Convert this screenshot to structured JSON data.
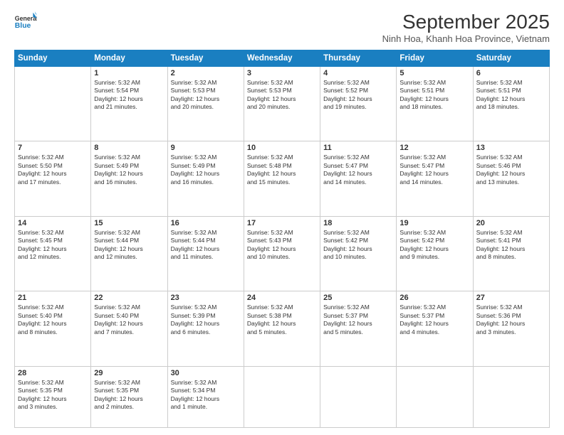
{
  "header": {
    "logo_line1": "General",
    "logo_line2": "Blue",
    "month": "September 2025",
    "location": "Ninh Hoa, Khanh Hoa Province, Vietnam"
  },
  "weekdays": [
    "Sunday",
    "Monday",
    "Tuesday",
    "Wednesday",
    "Thursday",
    "Friday",
    "Saturday"
  ],
  "rows": [
    [
      {
        "day": "",
        "lines": []
      },
      {
        "day": "1",
        "lines": [
          "Sunrise: 5:32 AM",
          "Sunset: 5:54 PM",
          "Daylight: 12 hours",
          "and 21 minutes."
        ]
      },
      {
        "day": "2",
        "lines": [
          "Sunrise: 5:32 AM",
          "Sunset: 5:53 PM",
          "Daylight: 12 hours",
          "and 20 minutes."
        ]
      },
      {
        "day": "3",
        "lines": [
          "Sunrise: 5:32 AM",
          "Sunset: 5:53 PM",
          "Daylight: 12 hours",
          "and 20 minutes."
        ]
      },
      {
        "day": "4",
        "lines": [
          "Sunrise: 5:32 AM",
          "Sunset: 5:52 PM",
          "Daylight: 12 hours",
          "and 19 minutes."
        ]
      },
      {
        "day": "5",
        "lines": [
          "Sunrise: 5:32 AM",
          "Sunset: 5:51 PM",
          "Daylight: 12 hours",
          "and 18 minutes."
        ]
      },
      {
        "day": "6",
        "lines": [
          "Sunrise: 5:32 AM",
          "Sunset: 5:51 PM",
          "Daylight: 12 hours",
          "and 18 minutes."
        ]
      }
    ],
    [
      {
        "day": "7",
        "lines": [
          "Sunrise: 5:32 AM",
          "Sunset: 5:50 PM",
          "Daylight: 12 hours",
          "and 17 minutes."
        ]
      },
      {
        "day": "8",
        "lines": [
          "Sunrise: 5:32 AM",
          "Sunset: 5:49 PM",
          "Daylight: 12 hours",
          "and 16 minutes."
        ]
      },
      {
        "day": "9",
        "lines": [
          "Sunrise: 5:32 AM",
          "Sunset: 5:49 PM",
          "Daylight: 12 hours",
          "and 16 minutes."
        ]
      },
      {
        "day": "10",
        "lines": [
          "Sunrise: 5:32 AM",
          "Sunset: 5:48 PM",
          "Daylight: 12 hours",
          "and 15 minutes."
        ]
      },
      {
        "day": "11",
        "lines": [
          "Sunrise: 5:32 AM",
          "Sunset: 5:47 PM",
          "Daylight: 12 hours",
          "and 14 minutes."
        ]
      },
      {
        "day": "12",
        "lines": [
          "Sunrise: 5:32 AM",
          "Sunset: 5:47 PM",
          "Daylight: 12 hours",
          "and 14 minutes."
        ]
      },
      {
        "day": "13",
        "lines": [
          "Sunrise: 5:32 AM",
          "Sunset: 5:46 PM",
          "Daylight: 12 hours",
          "and 13 minutes."
        ]
      }
    ],
    [
      {
        "day": "14",
        "lines": [
          "Sunrise: 5:32 AM",
          "Sunset: 5:45 PM",
          "Daylight: 12 hours",
          "and 12 minutes."
        ]
      },
      {
        "day": "15",
        "lines": [
          "Sunrise: 5:32 AM",
          "Sunset: 5:44 PM",
          "Daylight: 12 hours",
          "and 12 minutes."
        ]
      },
      {
        "day": "16",
        "lines": [
          "Sunrise: 5:32 AM",
          "Sunset: 5:44 PM",
          "Daylight: 12 hours",
          "and 11 minutes."
        ]
      },
      {
        "day": "17",
        "lines": [
          "Sunrise: 5:32 AM",
          "Sunset: 5:43 PM",
          "Daylight: 12 hours",
          "and 10 minutes."
        ]
      },
      {
        "day": "18",
        "lines": [
          "Sunrise: 5:32 AM",
          "Sunset: 5:42 PM",
          "Daylight: 12 hours",
          "and 10 minutes."
        ]
      },
      {
        "day": "19",
        "lines": [
          "Sunrise: 5:32 AM",
          "Sunset: 5:42 PM",
          "Daylight: 12 hours",
          "and 9 minutes."
        ]
      },
      {
        "day": "20",
        "lines": [
          "Sunrise: 5:32 AM",
          "Sunset: 5:41 PM",
          "Daylight: 12 hours",
          "and 8 minutes."
        ]
      }
    ],
    [
      {
        "day": "21",
        "lines": [
          "Sunrise: 5:32 AM",
          "Sunset: 5:40 PM",
          "Daylight: 12 hours",
          "and 8 minutes."
        ]
      },
      {
        "day": "22",
        "lines": [
          "Sunrise: 5:32 AM",
          "Sunset: 5:40 PM",
          "Daylight: 12 hours",
          "and 7 minutes."
        ]
      },
      {
        "day": "23",
        "lines": [
          "Sunrise: 5:32 AM",
          "Sunset: 5:39 PM",
          "Daylight: 12 hours",
          "and 6 minutes."
        ]
      },
      {
        "day": "24",
        "lines": [
          "Sunrise: 5:32 AM",
          "Sunset: 5:38 PM",
          "Daylight: 12 hours",
          "and 5 minutes."
        ]
      },
      {
        "day": "25",
        "lines": [
          "Sunrise: 5:32 AM",
          "Sunset: 5:37 PM",
          "Daylight: 12 hours",
          "and 5 minutes."
        ]
      },
      {
        "day": "26",
        "lines": [
          "Sunrise: 5:32 AM",
          "Sunset: 5:37 PM",
          "Daylight: 12 hours",
          "and 4 minutes."
        ]
      },
      {
        "day": "27",
        "lines": [
          "Sunrise: 5:32 AM",
          "Sunset: 5:36 PM",
          "Daylight: 12 hours",
          "and 3 minutes."
        ]
      }
    ],
    [
      {
        "day": "28",
        "lines": [
          "Sunrise: 5:32 AM",
          "Sunset: 5:35 PM",
          "Daylight: 12 hours",
          "and 3 minutes."
        ]
      },
      {
        "day": "29",
        "lines": [
          "Sunrise: 5:32 AM",
          "Sunset: 5:35 PM",
          "Daylight: 12 hours",
          "and 2 minutes."
        ]
      },
      {
        "day": "30",
        "lines": [
          "Sunrise: 5:32 AM",
          "Sunset: 5:34 PM",
          "Daylight: 12 hours",
          "and 1 minute."
        ]
      },
      {
        "day": "",
        "lines": []
      },
      {
        "day": "",
        "lines": []
      },
      {
        "day": "",
        "lines": []
      },
      {
        "day": "",
        "lines": []
      }
    ]
  ]
}
